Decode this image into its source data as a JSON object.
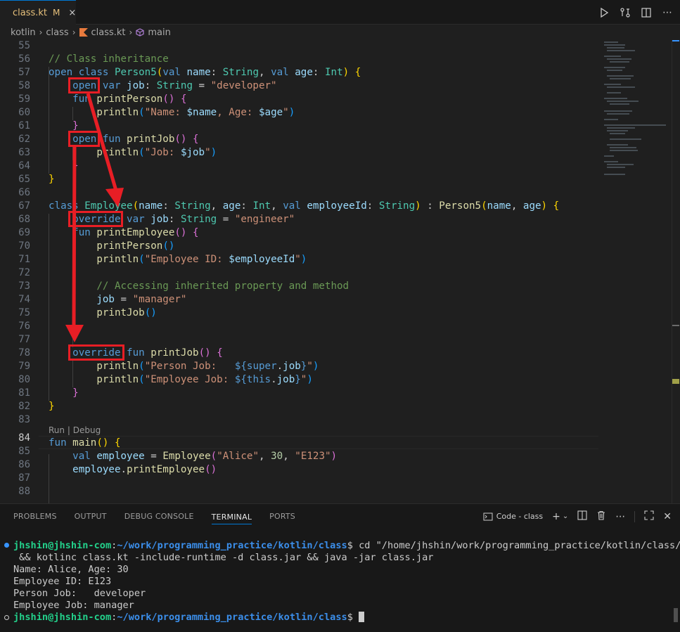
{
  "tab": {
    "label": "class.kt",
    "modified": "M"
  },
  "breadcrumb": {
    "items": [
      "kotlin",
      "class",
      "class.kt",
      "main"
    ]
  },
  "editor": {
    "lines": [
      {
        "n": "55",
        "t": ""
      },
      {
        "n": "56",
        "t": "// Class inheritance"
      },
      {
        "n": "57",
        "t": "open class Person5(val name: String, val age: Int) {"
      },
      {
        "n": "58",
        "t": "    open var job: String = \"developer\""
      },
      {
        "n": "59",
        "t": "    fun printPerson() {"
      },
      {
        "n": "60",
        "t": "        println(\"Name: $name, Age: $age\")"
      },
      {
        "n": "61",
        "t": "    }"
      },
      {
        "n": "62",
        "t": "    open fun printJob() {"
      },
      {
        "n": "63",
        "t": "        println(\"Job: $job\")"
      },
      {
        "n": "64",
        "t": "    }"
      },
      {
        "n": "65",
        "t": "}"
      },
      {
        "n": "66",
        "t": ""
      },
      {
        "n": "67",
        "t": "class Employee(name: String, age: Int, val employeeId: String) : Person5(name, age) {"
      },
      {
        "n": "68",
        "t": "    override var job: String = \"engineer\""
      },
      {
        "n": "69",
        "t": "    fun printEmployee() {"
      },
      {
        "n": "70",
        "t": "        printPerson()"
      },
      {
        "n": "71",
        "t": "        println(\"Employee ID: $employeeId\")"
      },
      {
        "n": "72",
        "t": ""
      },
      {
        "n": "73",
        "t": "        // Accessing inherited property and method"
      },
      {
        "n": "74",
        "t": "        job = \"manager\""
      },
      {
        "n": "75",
        "t": "        printJob()"
      },
      {
        "n": "76",
        "t": ""
      },
      {
        "n": "77",
        "t": ""
      },
      {
        "n": "78",
        "t": "    override fun printJob() {"
      },
      {
        "n": "79",
        "t": "        println(\"Person Job:   ${super.job}\")"
      },
      {
        "n": "80",
        "t": "        println(\"Employee Job: ${this.job}\")"
      },
      {
        "n": "81",
        "t": "    }"
      },
      {
        "n": "82",
        "t": "}"
      },
      {
        "n": "83",
        "t": ""
      },
      {
        "n": "84",
        "t": "fun main() {"
      },
      {
        "n": "85",
        "t": "    val employee = Employee(\"Alice\", 30, \"E123\")"
      },
      {
        "n": "86",
        "t": "    employee.printEmployee()"
      },
      {
        "n": "87",
        "t": ""
      },
      {
        "n": "88",
        "t": ""
      }
    ],
    "codelens": {
      "run": "Run",
      "separator": "|",
      "debug": "Debug"
    },
    "active_line": "84"
  },
  "panel": {
    "tabs": [
      "PROBLEMS",
      "OUTPUT",
      "DEBUG CONSOLE",
      "TERMINAL",
      "PORTS"
    ],
    "active_tab": "TERMINAL",
    "terminal_name": "Code - class"
  },
  "terminal": {
    "user_host": "jhshin@jhshin-com",
    "colon": ":",
    "path": "~/work/programming_practice/kotlin/class",
    "dollar": "$",
    "command_1": " cd \"/home/jhshin/work/programming_practice/kotlin/class/\"",
    "command_2": " && kotlinc class.kt -include-runtime -d class.jar && java -jar class.jar",
    "output": [
      "Name: Alice, Age: 30",
      "Employee ID: E123",
      "Person Job:   developer",
      "Employee Job: manager"
    ]
  },
  "colors": {
    "highlight_box": "#e81e25",
    "accent": "#0078d4",
    "prompt_user": "#23d18b",
    "prompt_path": "#3b8eea"
  }
}
